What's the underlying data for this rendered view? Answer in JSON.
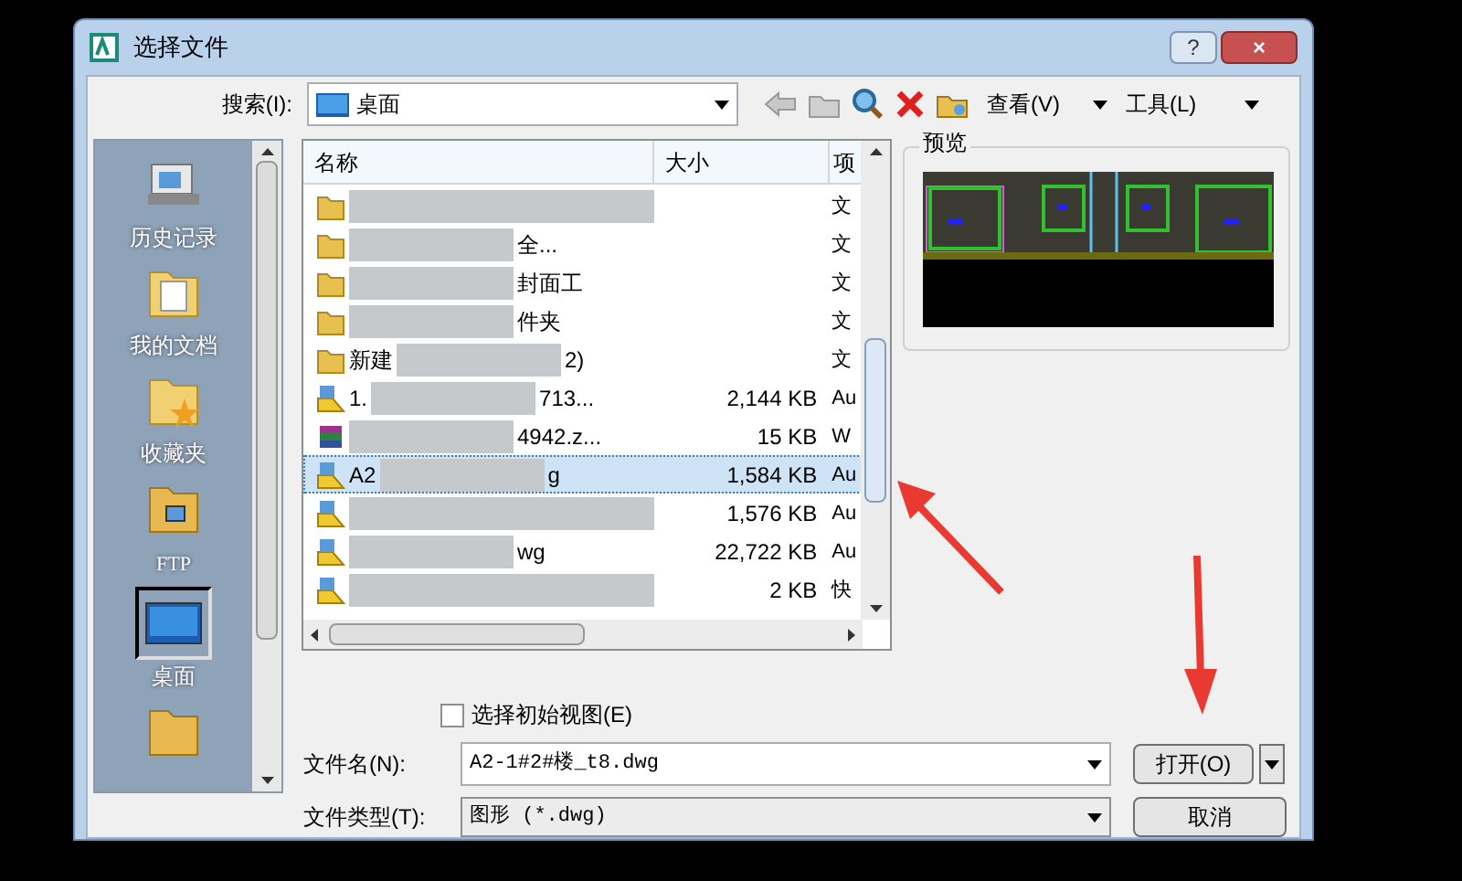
{
  "window": {
    "title": "选择文件",
    "help": "?",
    "close": "×"
  },
  "search": {
    "label": "搜索(I):",
    "location": "桌面"
  },
  "toolbar": {
    "view": "查看(V)",
    "tools": "工具(L)"
  },
  "sidebar": {
    "items": [
      {
        "label": "历史记录",
        "kind": "history",
        "selected": false
      },
      {
        "label": "我的文档",
        "kind": "documents",
        "selected": false
      },
      {
        "label": "收藏夹",
        "kind": "favorites",
        "selected": false
      },
      {
        "label": "FTP",
        "kind": "ftp",
        "selected": false
      },
      {
        "label": "桌面",
        "kind": "desktop",
        "selected": true
      },
      {
        "kind": "folder",
        "selected": false
      }
    ]
  },
  "table": {
    "columns": [
      "名称",
      "大小",
      "项"
    ],
    "rows": [
      {
        "kind": "folder",
        "type": "文",
        "selected": false
      },
      {
        "kind": "folder",
        "name": "全...",
        "type": "文",
        "selected": false
      },
      {
        "kind": "folder",
        "name": "封面工",
        "type": "文",
        "selected": false
      },
      {
        "kind": "folder",
        "name": "件夹",
        "type": "文",
        "selected": false
      },
      {
        "kind": "folder",
        "name": "2)",
        "type": "文",
        "prefix": "新建",
        "selected": false
      },
      {
        "kind": "dwg",
        "name": "713...",
        "size": "2,144 KB",
        "type": "Au",
        "prefix": "1.",
        "selected": false
      },
      {
        "kind": "archive",
        "name": "4942.z...",
        "size": "15 KB",
        "type": "W",
        "selected": false
      },
      {
        "kind": "dwg",
        "name": "g",
        "size": "1,584 KB",
        "type": "Au",
        "prefix": "A2",
        "selected": true
      },
      {
        "kind": "dwg",
        "size": "1,576 KB",
        "type": "Au",
        "selected": false
      },
      {
        "kind": "dwg",
        "name": "wg",
        "size": "22,722 KB",
        "type": "Au",
        "selected": false
      },
      {
        "kind": "dwg",
        "size": "2 KB",
        "type": "快",
        "selected": false
      }
    ]
  },
  "preview": {
    "label": "预览"
  },
  "initial_view": {
    "label": "选择初始视图(E)",
    "checked": false
  },
  "file_name": {
    "label": "文件名(N):",
    "value": "A2-1#2#楼_t8.dwg"
  },
  "file_type": {
    "label": "文件类型(T):",
    "value": "图形 (*.dwg)"
  },
  "buttons": {
    "open": "打开(O)",
    "cancel": "取消"
  }
}
